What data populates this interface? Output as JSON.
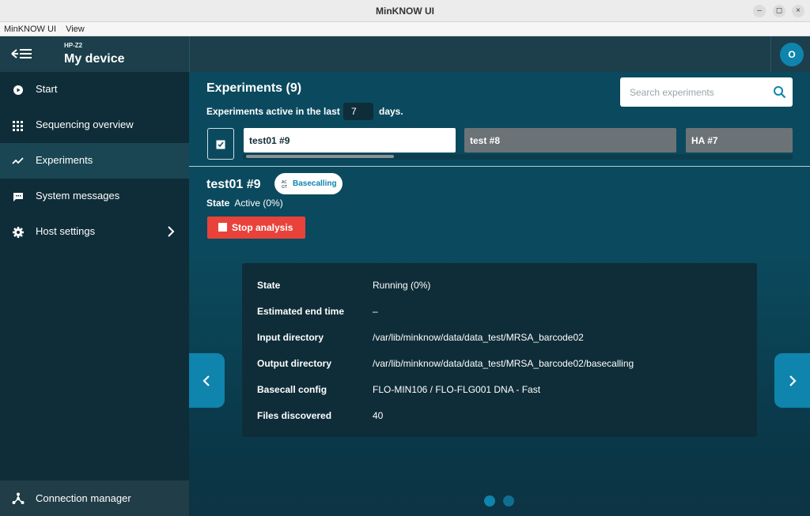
{
  "window": {
    "title": "MinKNOW UI"
  },
  "menu": {
    "items": [
      "MinKNOW UI",
      "View"
    ]
  },
  "sidebar": {
    "device_host": "HP-Z2",
    "device_name": "My device",
    "items": [
      {
        "label": "Start",
        "icon": "play-circle-icon"
      },
      {
        "label": "Sequencing overview",
        "icon": "grid-icon"
      },
      {
        "label": "Experiments",
        "icon": "trend-line-icon"
      },
      {
        "label": "System messages",
        "icon": "message-icon"
      },
      {
        "label": "Host settings",
        "icon": "gear-icon"
      }
    ],
    "active_item": "Experiments",
    "footer_label": "Connection manager"
  },
  "header": {
    "avatar_initial": "O"
  },
  "experiments": {
    "title": "Experiments (9)",
    "active_prefix": "Experiments active in the last",
    "active_days": "7",
    "active_suffix": "days.",
    "search_placeholder": "Search experiments",
    "tabs": [
      {
        "label": "test01 #9",
        "selected": true
      },
      {
        "label": "test #8",
        "selected": false
      },
      {
        "label": "HA #7",
        "selected": false
      }
    ]
  },
  "detail": {
    "name": "test01 #9",
    "badge": "Basecalling",
    "state_label": "State",
    "state_value": "Active (0%)",
    "stop_label": "Stop analysis"
  },
  "info": {
    "rows": [
      {
        "key": "State",
        "value": "Running (0%)"
      },
      {
        "key": "Estimated end time",
        "value": "–"
      },
      {
        "key": "Input directory",
        "value": "/var/lib/minknow/data/data_test/MRSA_barcode02"
      },
      {
        "key": "Output directory",
        "value": "/var/lib/minknow/data/data_test/MRSA_barcode02/basecalling"
      },
      {
        "key": "Basecall config",
        "value": "FLO-MIN106 / FLO-FLG001 DNA - Fast"
      },
      {
        "key": "Files discovered",
        "value": "40"
      }
    ]
  },
  "carousel": {
    "pages": 2,
    "current": 1
  },
  "colors": {
    "accent": "#0f84ad",
    "stop": "#e8423b",
    "sidebar": "#0f2d38",
    "panel": "#0b4a5e"
  }
}
